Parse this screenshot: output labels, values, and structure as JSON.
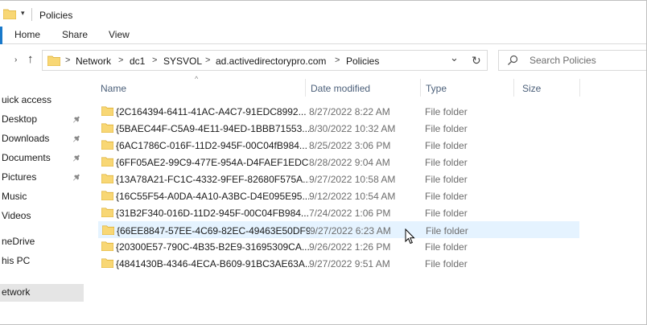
{
  "window": {
    "title": "Policies",
    "qa_dropdown": "▾"
  },
  "ribbon": {
    "tabs": [
      {
        "label": "Home"
      },
      {
        "label": "Share"
      },
      {
        "label": "View"
      }
    ]
  },
  "nav_buttons": {
    "up_arrow": "↑",
    "forward_chevron": "›"
  },
  "address": {
    "crumbs": [
      "Network",
      "dc1",
      "SYSVOL",
      "ad.activedirectorypro.com",
      "Policies"
    ],
    "separator": ">",
    "dropdown": "⌄",
    "refresh_glyph": "↻"
  },
  "search": {
    "placeholder": "Search Policies"
  },
  "navpane": {
    "items": [
      {
        "label": "uick access",
        "pinned": false
      },
      {
        "label": "Desktop",
        "pinned": true
      },
      {
        "label": "Downloads",
        "pinned": true
      },
      {
        "label": "Documents",
        "pinned": true
      },
      {
        "label": "Pictures",
        "pinned": true
      },
      {
        "label": "Music",
        "pinned": false
      },
      {
        "label": "Videos",
        "pinned": false
      },
      {
        "label": "neDrive",
        "pinned": false
      },
      {
        "label": "his PC",
        "pinned": false
      },
      {
        "label": "etwork",
        "pinned": false,
        "selected": true
      }
    ]
  },
  "columns": {
    "name": "Name",
    "date": "Date modified",
    "type": "Type",
    "size": "Size",
    "sort_caret": "^"
  },
  "files": [
    {
      "name": "{2C164394-6411-41AC-A4C7-91EDC8992...",
      "date": "8/27/2022 8:22 AM",
      "type": "File folder"
    },
    {
      "name": "{5BAEC44F-C5A9-4E11-94ED-1BBB71553...",
      "date": "8/30/2022 10:32 AM",
      "type": "File folder"
    },
    {
      "name": "{6AC1786C-016F-11D2-945F-00C04fB984...",
      "date": "8/25/2022 3:06 PM",
      "type": "File folder"
    },
    {
      "name": "{6FF05AE2-99C9-477E-954A-D4FAEF1EDC...",
      "date": "8/28/2022 9:04 AM",
      "type": "File folder"
    },
    {
      "name": "{13A78A21-FC1C-4332-9FEF-82680F575A...",
      "date": "9/27/2022 10:58 AM",
      "type": "File folder"
    },
    {
      "name": "{16C55F54-A0DA-4A10-A3BC-D4E095E95...",
      "date": "9/12/2022 10:54 AM",
      "type": "File folder"
    },
    {
      "name": "{31B2F340-016D-11D2-945F-00C04FB984...",
      "date": "7/24/2022 1:06 PM",
      "type": "File folder"
    },
    {
      "name": "{66EE8847-57EE-4C69-82EC-49463E50DF9...",
      "date": "9/27/2022 6:23 AM",
      "type": "File folder",
      "hover": true
    },
    {
      "name": "{20300E57-790C-4B35-B2E9-31695309CA...",
      "date": "9/26/2022 1:26 PM",
      "type": "File folder"
    },
    {
      "name": "{4841430B-4346-4ECA-B609-91BC3AE63A...",
      "date": "9/27/2022 9:51 AM",
      "type": "File folder"
    }
  ],
  "colors": {
    "accent": "#1979ca",
    "hover_row": "#e5f3ff",
    "folder": "#f8d775",
    "header_text": "#4c607a"
  }
}
